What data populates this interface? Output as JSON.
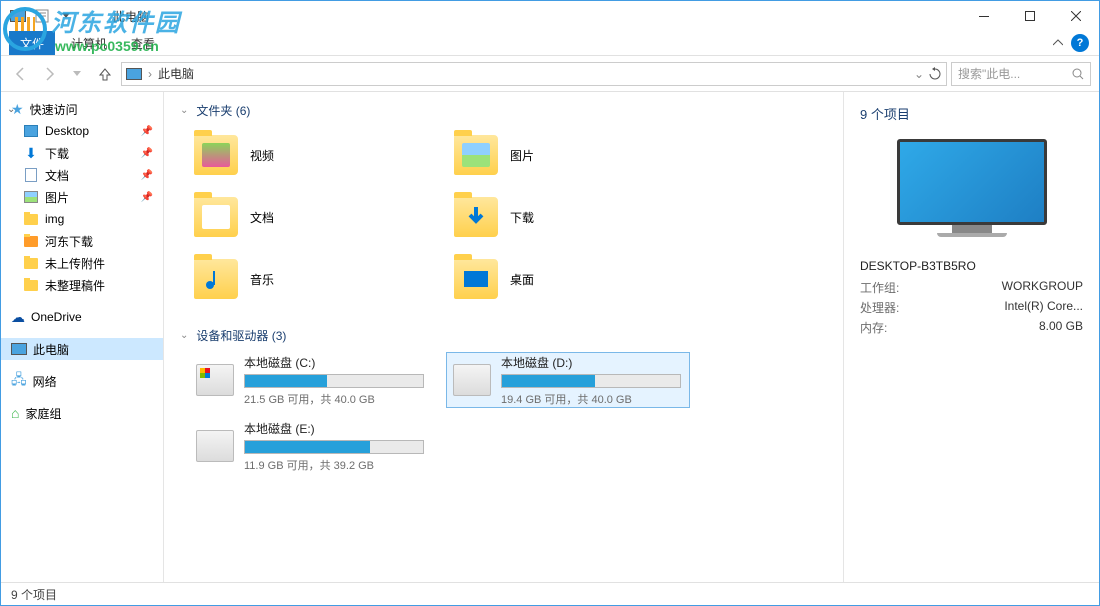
{
  "window": {
    "title": "此电脑"
  },
  "ribbon": {
    "file": "文件",
    "tabs": [
      "计算机",
      "查看"
    ]
  },
  "address": {
    "location": "此电脑",
    "search_placeholder": "搜索\"此电..."
  },
  "sidebar": {
    "quick_access": "快速访问",
    "items": [
      {
        "label": "Desktop",
        "pinned": true,
        "icon": "desktop"
      },
      {
        "label": "下载",
        "pinned": true,
        "icon": "download"
      },
      {
        "label": "文档",
        "pinned": true,
        "icon": "doc"
      },
      {
        "label": "图片",
        "pinned": true,
        "icon": "img"
      },
      {
        "label": "img",
        "pinned": false,
        "icon": "folder"
      },
      {
        "label": "河东下载",
        "pinned": false,
        "icon": "folder-orange"
      },
      {
        "label": "未上传附件",
        "pinned": false,
        "icon": "folder"
      },
      {
        "label": "未整理稿件",
        "pinned": false,
        "icon": "folder"
      }
    ],
    "onedrive": "OneDrive",
    "this_pc": "此电脑",
    "network": "网络",
    "homegroup": "家庭组"
  },
  "content": {
    "folders_header": "文件夹 (6)",
    "folders": [
      {
        "label": "视频",
        "type": "video"
      },
      {
        "label": "图片",
        "type": "image"
      },
      {
        "label": "文档",
        "type": "doc"
      },
      {
        "label": "下载",
        "type": "download"
      },
      {
        "label": "音乐",
        "type": "music"
      },
      {
        "label": "桌面",
        "type": "desktop"
      }
    ],
    "drives_header": "设备和驱动器 (3)",
    "drives": [
      {
        "name": "本地磁盘 (C:)",
        "free_text": "21.5 GB 可用，共 40.0 GB",
        "fill_pct": 46,
        "system": true,
        "selected": false
      },
      {
        "name": "本地磁盘 (D:)",
        "free_text": "19.4 GB 可用，共 40.0 GB",
        "fill_pct": 52,
        "system": false,
        "selected": true
      },
      {
        "name": "本地磁盘 (E:)",
        "free_text": "11.9 GB 可用，共 39.2 GB",
        "fill_pct": 70,
        "system": false,
        "selected": false
      }
    ]
  },
  "details": {
    "title": "9 个项目",
    "computer_name": "DESKTOP-B3TB5RO",
    "rows": [
      {
        "label": "工作组:",
        "value": "WORKGROUP"
      },
      {
        "label": "处理器:",
        "value": "Intel(R) Core..."
      },
      {
        "label": "内存:",
        "value": "8.00 GB"
      }
    ]
  },
  "status": {
    "text": "9 个项目"
  },
  "watermark": {
    "text": "河东软件园",
    "url": "www.pc0359.cn"
  }
}
